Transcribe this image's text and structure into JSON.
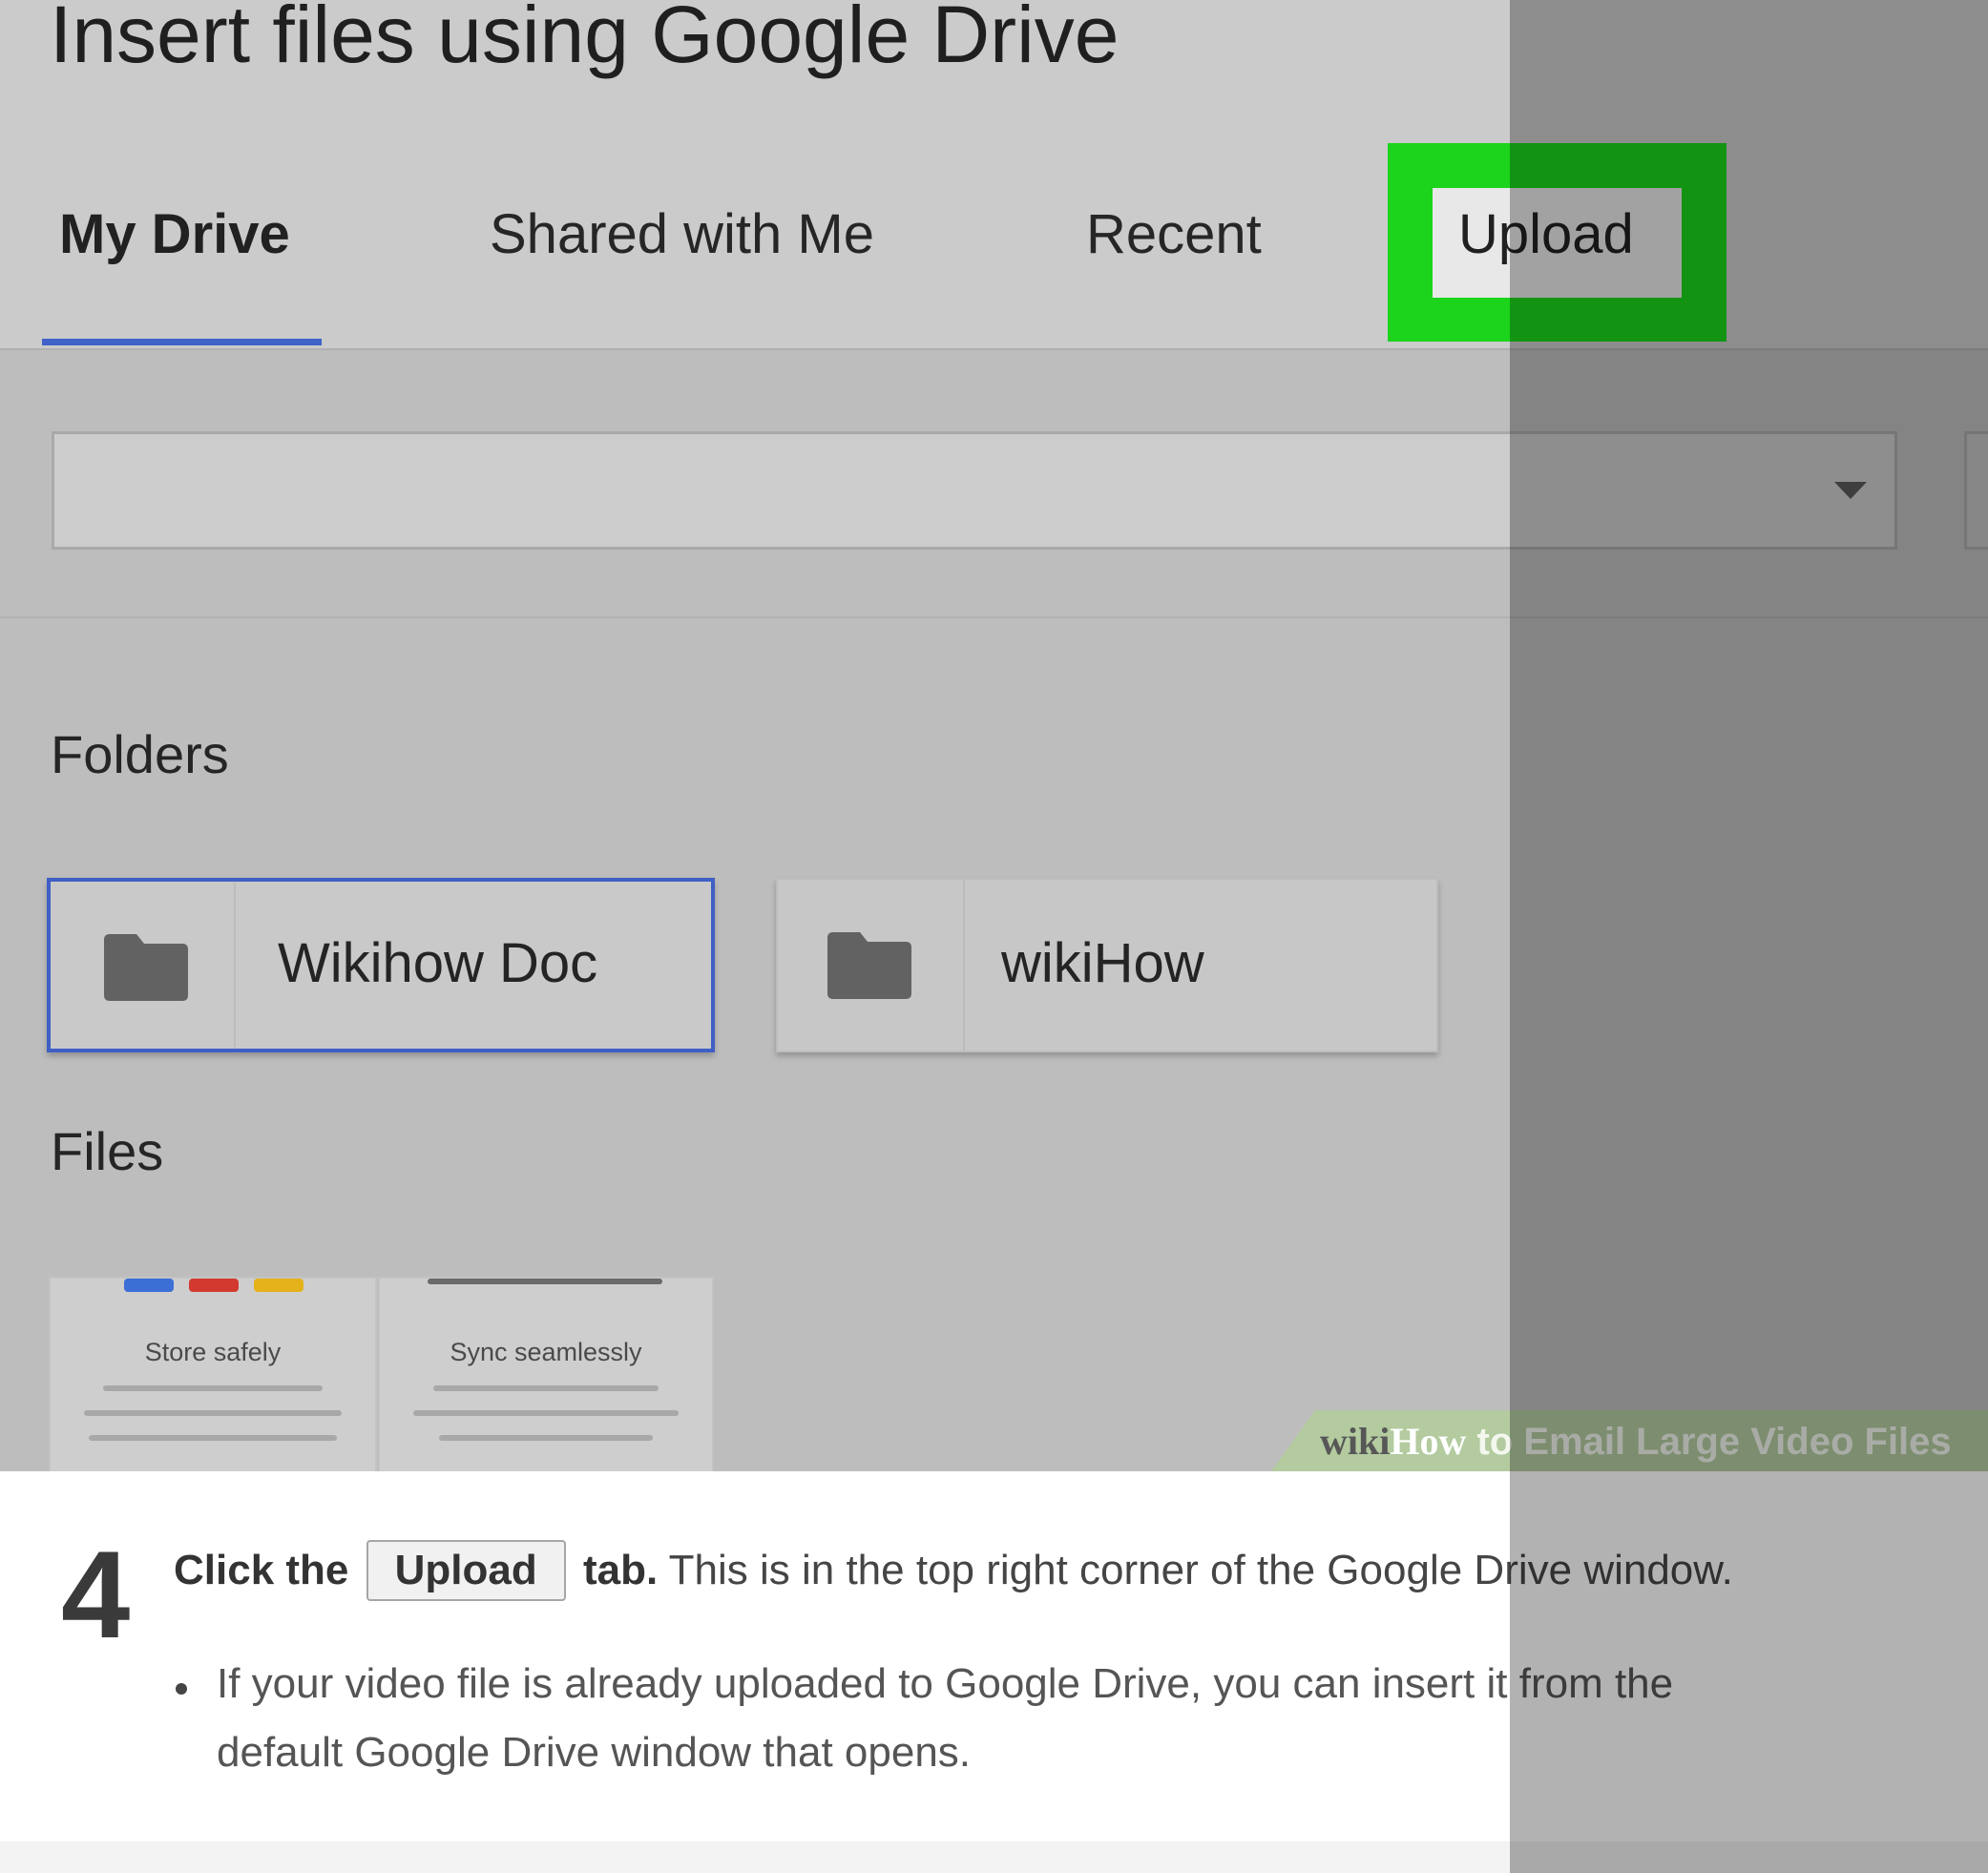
{
  "dialog": {
    "title": "Insert files using Google Drive",
    "tabs": [
      {
        "label": "My Drive",
        "active": true
      },
      {
        "label": "Shared with Me"
      },
      {
        "label": "Recent"
      },
      {
        "label": "Upload",
        "highlighted": true
      }
    ],
    "folder_select": {
      "value": ""
    },
    "folders_heading": "Folders",
    "folders": [
      {
        "name": "Wikihow Doc",
        "selected": true
      },
      {
        "name": "wikiHow"
      }
    ],
    "files_heading": "Files",
    "files": [
      {
        "heading": "Store safely"
      },
      {
        "heading": "Sync seamlessly"
      }
    ]
  },
  "watermark": {
    "wiki": "wiki",
    "how": "How",
    "rest": " to Email Large Video Files"
  },
  "step": {
    "number": "4",
    "lead": "Click the",
    "button_label": "Upload",
    "lead_end": "tab.",
    "text": "This is in the top right corner of the Google Drive window.",
    "bullet_line_1": "If your video file is already uploaded to Google Drive, you can insert it from the",
    "bullet_line_2": "default Google Drive window that opens."
  },
  "colors": {
    "highlight": "#1bd41b",
    "active_tab_underline": "#3f62c8",
    "google_blue": "#3b6fd6",
    "google_red": "#d23a2f",
    "google_yellow": "#e6b21c"
  },
  "icons": [
    "folder-icon",
    "chevron-down-icon"
  ]
}
